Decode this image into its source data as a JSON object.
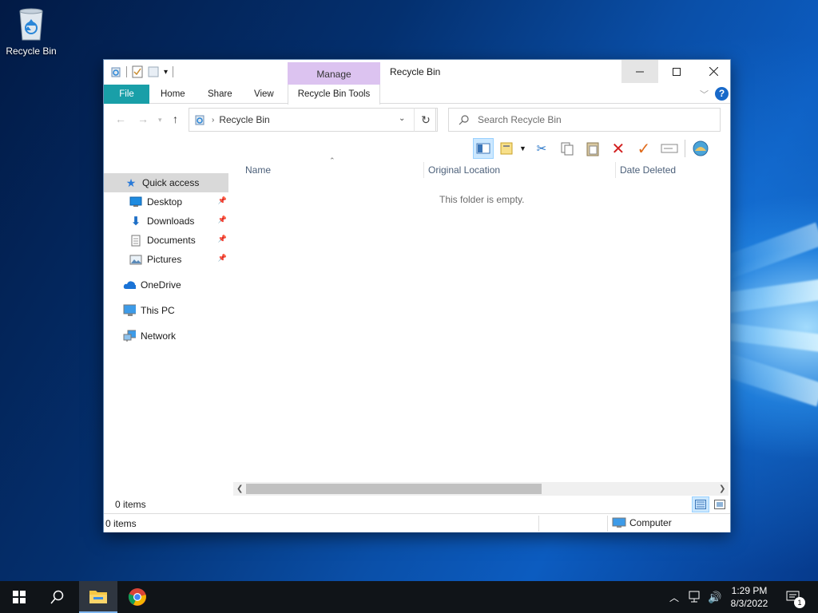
{
  "desktop": {
    "icons": [
      {
        "label": "Recycle Bin",
        "icon": "recycle-bin-icon"
      }
    ]
  },
  "window": {
    "title": "Recycle Bin",
    "contextual_tab": "Manage",
    "tabs": [
      "File",
      "Home",
      "Share",
      "View",
      "Recycle Bin Tools"
    ],
    "help": "?",
    "address": {
      "crumb": "Recycle Bin"
    },
    "search": {
      "placeholder": "Search Recycle Bin"
    },
    "columns": [
      "Name",
      "Original Location",
      "Date Deleted"
    ],
    "empty_message": "This folder is empty.",
    "item_count": "0 items",
    "status": {
      "left": "0 items",
      "right": "Computer"
    },
    "nav": [
      {
        "label": "Quick access",
        "icon": "star-icon",
        "selected": true
      },
      {
        "label": "Desktop",
        "icon": "desktop-icon",
        "pinned": true
      },
      {
        "label": "Downloads",
        "icon": "download-arrow-icon",
        "pinned": true
      },
      {
        "label": "Documents",
        "icon": "document-icon",
        "pinned": true
      },
      {
        "label": "Pictures",
        "icon": "pictures-icon",
        "pinned": true
      },
      {
        "label": "OneDrive",
        "icon": "cloud-icon"
      },
      {
        "label": "This PC",
        "icon": "computer-icon"
      },
      {
        "label": "Network",
        "icon": "network-icon"
      }
    ],
    "toolbar": [
      "preview-pane-icon",
      "new-folder-icon",
      "cut-icon",
      "copy-icon",
      "paste-icon",
      "delete-icon",
      "check-icon",
      "rename-icon",
      "properties-icon"
    ]
  },
  "taskbar": {
    "apps": [
      "start-icon",
      "search-icon",
      "file-explorer-icon",
      "chrome-icon"
    ],
    "clock": {
      "time": "1:29 PM",
      "date": "8/3/2022"
    },
    "notification_count": "1"
  },
  "colors": {
    "file_tab": "#199fa8",
    "manage_tab": "#dcc3f0",
    "selection": "#cce8ff",
    "taskbar": "#101418"
  }
}
